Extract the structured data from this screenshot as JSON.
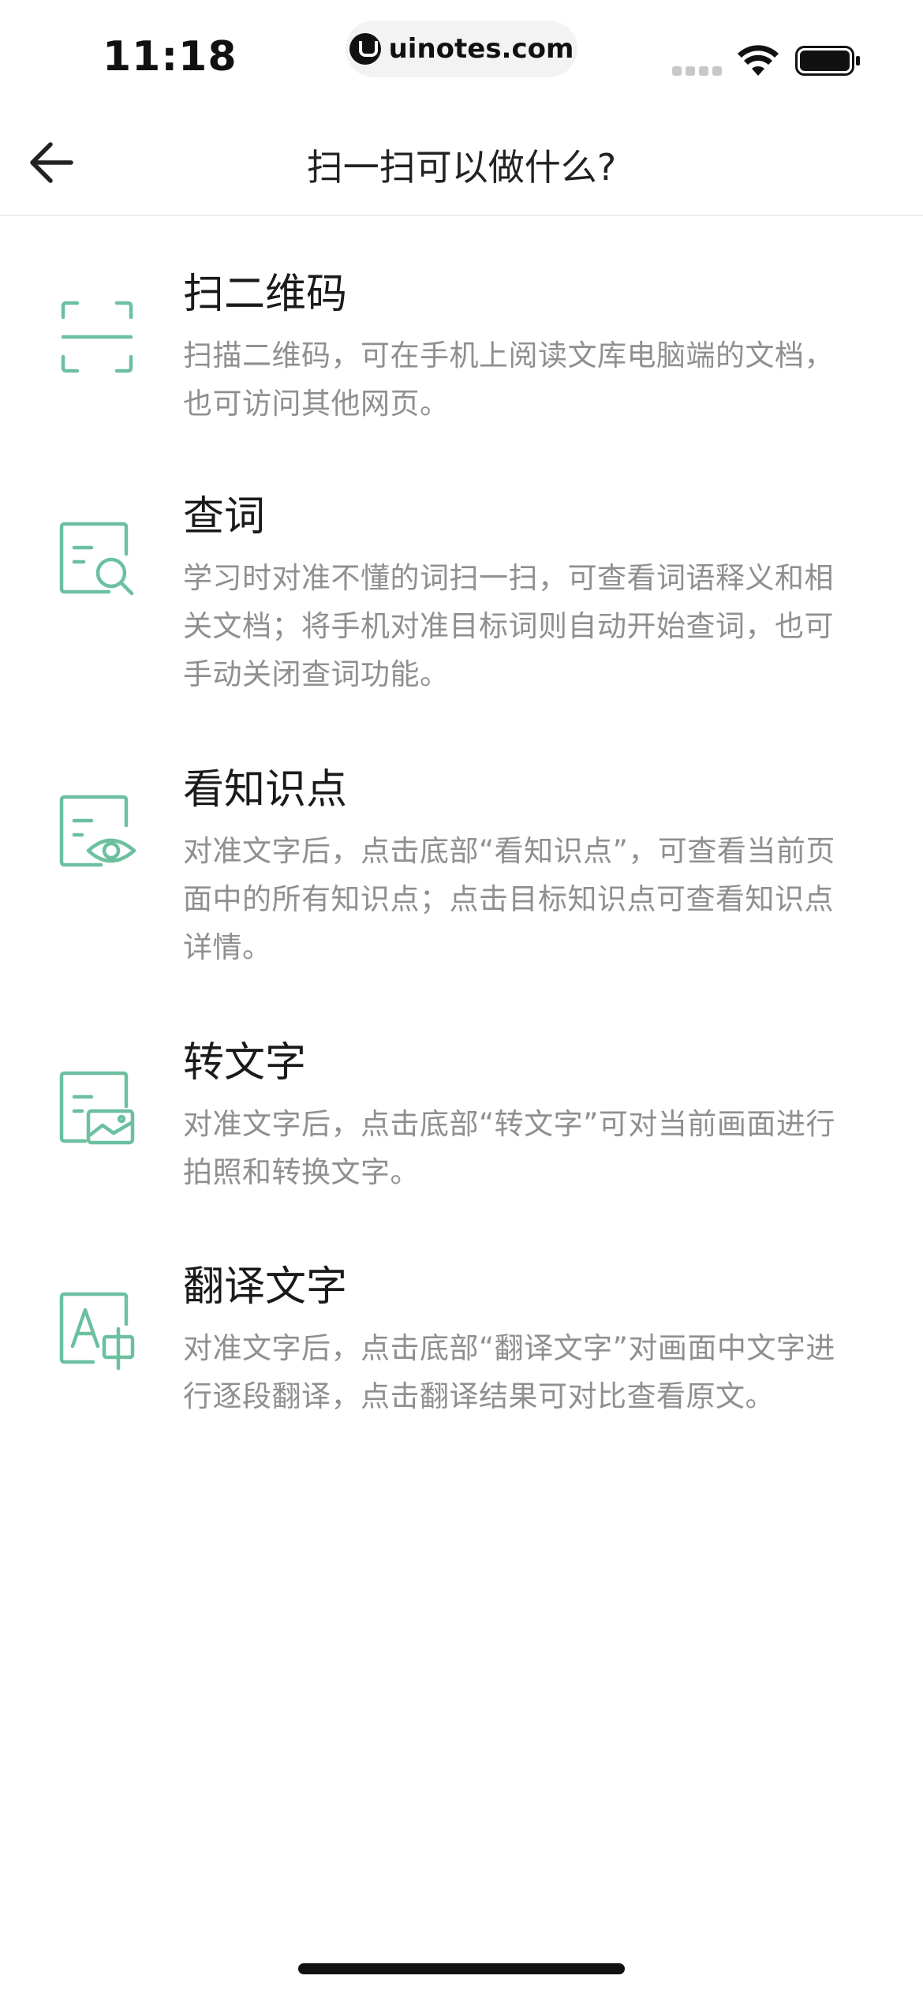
{
  "status_bar": {
    "time": "11:18",
    "watermark": "uinotes.com"
  },
  "nav": {
    "title": "扫一扫可以做什么?",
    "back_icon": "arrow-left-icon"
  },
  "colors": {
    "accent": "#6cc0a0",
    "title_text": "#1a1a1a",
    "desc_text": "#8f8f8f"
  },
  "features": [
    {
      "icon": "scan-frame-icon",
      "title": "扫二维码",
      "desc": "扫描二维码，可在手机上阅读文库电脑端的文档，也可访问其他网页。"
    },
    {
      "icon": "document-search-icon",
      "title": "查词",
      "desc": "学习时对准不懂的词扫一扫，可查看词语释义和相关文档；将手机对准目标词则自动开始查词，也可手动关闭查词功能。"
    },
    {
      "icon": "document-eye-icon",
      "title": "看知识点",
      "desc": "对准文字后，点击底部“看知识点”，可查看当前页面中的所有知识点；点击目标知识点可查看知识点详情。"
    },
    {
      "icon": "document-image-icon",
      "title": "转文字",
      "desc": "对准文字后，点击底部“转文字”可对当前画面进行拍照和转换文字。"
    },
    {
      "icon": "translate-icon",
      "title": "翻译文字",
      "desc": "对准文字后，点击底部“翻译文字”对画面中文字进行逐段翻译，点击翻译结果可对比查看原文。"
    }
  ]
}
